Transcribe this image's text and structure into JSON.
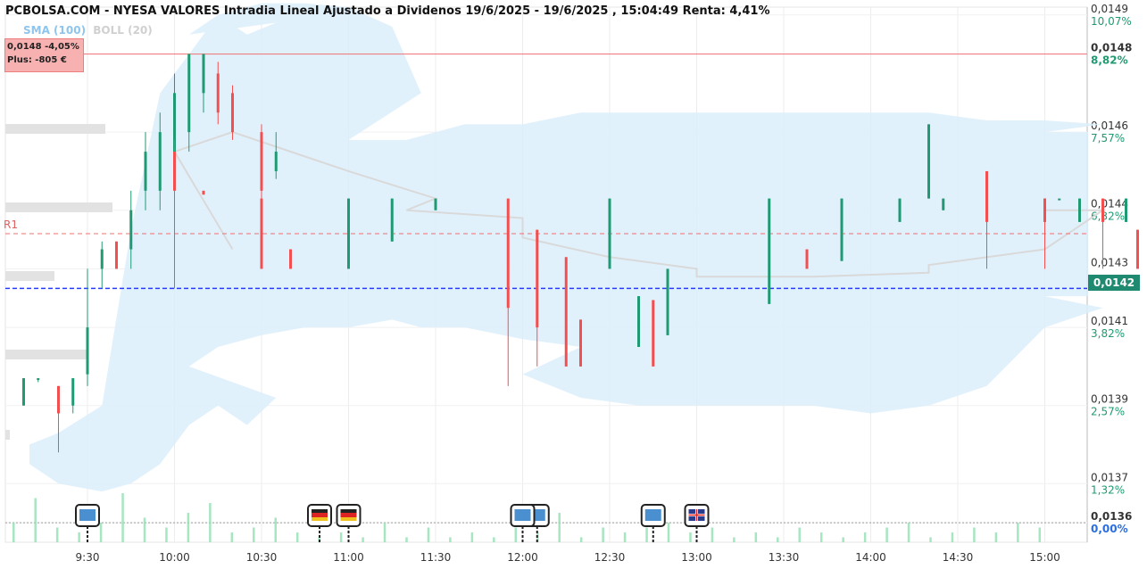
{
  "title": "PCBOLSA.COM - NYESA VALORES Intradia Lineal Ajustado a Dividenos 19/6/2025 - 19/6/2025 , 15:04:49 Renta: 4,41%",
  "indicators": {
    "sma": "SMA (100)",
    "boll": "BOLL (20)"
  },
  "price_box": {
    "line1": "0,0148  -4,05%",
    "line2": "Plus: -805 €"
  },
  "r1_label": "R1",
  "current_price_label": "0,0142",
  "colors": {
    "up": "#1f9a73",
    "down": "#f25050",
    "band": "#dceefb",
    "sma": "#d9d9d9",
    "resistance": "#f08080",
    "current": "#2a3cf0",
    "volume": "#90e0b0"
  },
  "chart_data": {
    "type": "line",
    "ylim": [
      0.01355,
      0.01492
    ],
    "y_ticks": [
      {
        "price": "0,0149",
        "pct": "10,07%",
        "value": 0.0149
      },
      {
        "price": "0,0148",
        "pct": "8,82%",
        "value": 0.0148
      },
      {
        "price": "0,0146",
        "pct": "7,57%",
        "value": 0.0146
      },
      {
        "price": "0,0144",
        "pct": "6,32%",
        "value": 0.0144
      },
      {
        "price": "0,0143",
        "pct": "",
        "value": 0.01425
      },
      {
        "price": "0,0141",
        "pct": "3,82%",
        "value": 0.0141
      },
      {
        "price": "0,0139",
        "pct": "2,57%",
        "value": 0.0139
      },
      {
        "price": "0,0137",
        "pct": "1,32%",
        "value": 0.0137
      },
      {
        "price": "0,0136",
        "pct": "0,00%",
        "value": 0.0136
      }
    ],
    "x_ticks": [
      "9:30",
      "10:00",
      "10:30",
      "11:00",
      "11:30",
      "12:00",
      "12:30",
      "13:00",
      "13:30",
      "14:00",
      "14:30",
      "15:00"
    ],
    "x_range_minutes": [
      9.05,
      15.3
    ],
    "reference_lines": {
      "resistance_high": 0.0148,
      "r1": 0.01434,
      "current": 0.0142,
      "base": 0.0136
    },
    "bollinger": [
      [
        9.1,
        0.0138,
        0.01375
      ],
      [
        9.2,
        0.01383,
        0.0137
      ],
      [
        9.35,
        0.0139,
        0.01368
      ],
      [
        9.45,
        0.01435,
        0.0137
      ],
      [
        9.55,
        0.0147,
        0.01375
      ],
      [
        9.65,
        0.0148,
        0.01385
      ],
      [
        9.75,
        0.0149,
        0.0139
      ],
      [
        9.85,
        0.01485,
        0.01385
      ],
      [
        9.95,
        0.01488,
        0.01392
      ],
      [
        10.05,
        0.01485,
        0.014
      ],
      [
        10.15,
        0.0149,
        0.01405
      ],
      [
        10.3,
        0.01493,
        0.01408
      ],
      [
        10.45,
        0.01493,
        0.0141
      ],
      [
        10.6,
        0.01492,
        0.0141
      ],
      [
        10.75,
        0.01487,
        0.01412
      ],
      [
        10.85,
        0.0147,
        0.0141
      ],
      [
        11.0,
        0.01458,
        0.0141
      ],
      [
        11.2,
        0.01458,
        0.0141
      ],
      [
        11.4,
        0.01462,
        0.0141
      ],
      [
        11.6,
        0.01462,
        0.01407
      ],
      [
        11.8,
        0.01465,
        0.01405
      ],
      [
        12.0,
        0.01465,
        0.01398
      ],
      [
        12.2,
        0.01465,
        0.01392
      ],
      [
        12.4,
        0.01465,
        0.0139
      ],
      [
        12.6,
        0.01465,
        0.0139
      ],
      [
        12.8,
        0.01465,
        0.0139
      ],
      [
        13.0,
        0.01465,
        0.0139
      ],
      [
        13.2,
        0.01465,
        0.0139
      ],
      [
        13.4,
        0.01465,
        0.0139
      ],
      [
        13.6,
        0.01465,
        0.01388
      ],
      [
        13.8,
        0.01465,
        0.01388
      ],
      [
        14.0,
        0.01465,
        0.01388
      ],
      [
        14.2,
        0.01465,
        0.0139
      ],
      [
        14.4,
        0.01463,
        0.01395
      ],
      [
        14.6,
        0.01463,
        0.0141
      ],
      [
        14.8,
        0.01462,
        0.01415
      ],
      [
        15.0,
        0.0146,
        0.01418
      ],
      [
        15.15,
        0.0146,
        0.01418
      ]
    ],
    "sma": [
      [
        9.8,
        0.0143
      ],
      [
        10.0,
        0.01455
      ],
      [
        10.2,
        0.0146
      ],
      [
        10.4,
        0.01455
      ],
      [
        10.6,
        0.0145
      ],
      [
        10.9,
        0.01443
      ],
      [
        11.2,
        0.0144
      ],
      [
        11.6,
        0.01438
      ],
      [
        12.0,
        0.01433
      ],
      [
        12.3,
        0.01428
      ],
      [
        12.6,
        0.01425
      ],
      [
        13.0,
        0.01423
      ],
      [
        13.4,
        0.01423
      ],
      [
        13.8,
        0.01424
      ],
      [
        14.2,
        0.01426
      ],
      [
        14.6,
        0.0143
      ],
      [
        14.8,
        0.0144
      ],
      [
        15.0,
        0.0144
      ],
      [
        15.15,
        0.0144
      ]
    ],
    "ohlc": [
      {
        "t": 9.08,
        "o": 0.01397,
        "c": 0.0139,
        "h": 0.01397,
        "l": 0.0139,
        "up": true
      },
      {
        "t": 9.13,
        "o": 0.01397,
        "c": 0.01397,
        "h": 0.01397,
        "l": 0.01396,
        "up": true
      },
      {
        "t": 9.2,
        "o": 0.01395,
        "c": 0.01388,
        "h": 0.01395,
        "l": 0.01378,
        "up": false
      },
      {
        "t": 9.25,
        "o": 0.0139,
        "c": 0.01397,
        "h": 0.01397,
        "l": 0.01388,
        "up": true
      },
      {
        "t": 9.3,
        "o": 0.01398,
        "c": 0.0141,
        "h": 0.01425,
        "l": 0.01395,
        "up": true
      },
      {
        "t": 9.35,
        "o": 0.01425,
        "c": 0.0143,
        "h": 0.01432,
        "l": 0.0142,
        "up": true
      },
      {
        "t": 9.4,
        "o": 0.01432,
        "c": 0.01425,
        "h": 0.01432,
        "l": 0.01425,
        "up": false
      },
      {
        "t": 9.45,
        "o": 0.0143,
        "c": 0.0144,
        "h": 0.01445,
        "l": 0.01425,
        "up": true
      },
      {
        "t": 9.5,
        "o": 0.01445,
        "c": 0.01455,
        "h": 0.0146,
        "l": 0.0144,
        "up": true
      },
      {
        "t": 9.55,
        "o": 0.01445,
        "c": 0.0146,
        "h": 0.01465,
        "l": 0.0144,
        "up": true
      },
      {
        "t": 9.6,
        "o": 0.01455,
        "c": 0.0147,
        "h": 0.01475,
        "l": 0.0145,
        "up": true
      },
      {
        "t": 9.65,
        "o": 0.0146,
        "c": 0.0148,
        "h": 0.0148,
        "l": 0.01455,
        "up": true
      },
      {
        "t": 9.7,
        "o": 0.0147,
        "c": 0.0148,
        "h": 0.0148,
        "l": 0.01465,
        "up": true
      },
      {
        "t": 9.75,
        "o": 0.01475,
        "c": 0.01465,
        "h": 0.01478,
        "l": 0.01462,
        "up": false
      },
      {
        "t": 9.8,
        "o": 0.0147,
        "c": 0.0146,
        "h": 0.01472,
        "l": 0.01458,
        "up": false
      },
      {
        "t": 9.9,
        "o": 0.0146,
        "c": 0.01445,
        "h": 0.01462,
        "l": 0.0144,
        "up": false
      },
      {
        "t": 9.95,
        "o": 0.0145,
        "c": 0.01455,
        "h": 0.0146,
        "l": 0.01448,
        "up": true
      },
      {
        "t": 10.0,
        "o": 0.01455,
        "c": 0.01445,
        "h": 0.01458,
        "l": 0.0142,
        "up": false
      },
      {
        "t": 10.1,
        "o": 0.01445,
        "c": 0.01444,
        "h": 0.01445,
        "l": 0.01444,
        "up": false
      },
      {
        "t": 10.3,
        "o": 0.01443,
        "c": 0.01425,
        "h": 0.01443,
        "l": 0.01425,
        "up": false
      },
      {
        "t": 10.4,
        "o": 0.0143,
        "c": 0.01425,
        "h": 0.0143,
        "l": 0.01425,
        "up": false
      },
      {
        "t": 10.6,
        "o": 0.01425,
        "c": 0.01443,
        "h": 0.01443,
        "l": 0.01425,
        "up": true
      },
      {
        "t": 10.75,
        "o": 0.01432,
        "c": 0.01443,
        "h": 0.01443,
        "l": 0.01432,
        "up": true
      },
      {
        "t": 10.9,
        "o": 0.0144,
        "c": 0.01443,
        "h": 0.01443,
        "l": 0.0144,
        "up": true
      },
      {
        "t": 11.55,
        "o": 0.01443,
        "c": 0.01415,
        "h": 0.01443,
        "l": 0.01395,
        "up": false
      },
      {
        "t": 11.9,
        "o": 0.01425,
        "c": 0.01443,
        "h": 0.01443,
        "l": 0.01425,
        "up": true
      },
      {
        "t": 12.05,
        "o": 0.01435,
        "c": 0.0141,
        "h": 0.01435,
        "l": 0.014,
        "up": false
      },
      {
        "t": 12.15,
        "o": 0.01428,
        "c": 0.014,
        "h": 0.01428,
        "l": 0.014,
        "up": false
      },
      {
        "t": 12.2,
        "o": 0.01412,
        "c": 0.014,
        "h": 0.01412,
        "l": 0.014,
        "up": false
      },
      {
        "t": 12.4,
        "o": 0.01405,
        "c": 0.01418,
        "h": 0.01418,
        "l": 0.01405,
        "up": true
      },
      {
        "t": 12.45,
        "o": 0.01417,
        "c": 0.014,
        "h": 0.01417,
        "l": 0.014,
        "up": false
      },
      {
        "t": 12.5,
        "o": 0.01408,
        "c": 0.01425,
        "h": 0.01425,
        "l": 0.01408,
        "up": true
      },
      {
        "t": 12.85,
        "o": 0.01416,
        "c": 0.01443,
        "h": 0.01443,
        "l": 0.01416,
        "up": true
      },
      {
        "t": 12.98,
        "o": 0.0143,
        "c": 0.01425,
        "h": 0.0143,
        "l": 0.01425,
        "up": false
      },
      {
        "t": 13.5,
        "o": 0.01427,
        "c": 0.01443,
        "h": 0.01443,
        "l": 0.01427,
        "up": true
      },
      {
        "t": 13.7,
        "o": 0.01437,
        "c": 0.01443,
        "h": 0.01443,
        "l": 0.01437,
        "up": true
      },
      {
        "t": 13.85,
        "o": 0.0144,
        "c": 0.01443,
        "h": 0.01443,
        "l": 0.0144,
        "up": true
      },
      {
        "t": 14.2,
        "o": 0.01443,
        "c": 0.01462,
        "h": 0.01462,
        "l": 0.01443,
        "up": true
      },
      {
        "t": 14.4,
        "o": 0.0145,
        "c": 0.01437,
        "h": 0.0145,
        "l": 0.01425,
        "up": false
      },
      {
        "t": 14.6,
        "o": 0.01443,
        "c": 0.01437,
        "h": 0.01443,
        "l": 0.01425,
        "up": false
      },
      {
        "t": 14.72,
        "o": 0.01437,
        "c": 0.01443,
        "h": 0.01443,
        "l": 0.01437,
        "up": true
      },
      {
        "t": 14.88,
        "o": 0.01437,
        "c": 0.01443,
        "h": 0.01443,
        "l": 0.01437,
        "up": true
      },
      {
        "t": 15.0,
        "o": 0.01443,
        "c": 0.01437,
        "h": 0.01443,
        "l": 0.01425,
        "up": false
      },
      {
        "t": 15.05,
        "o": 0.01443,
        "c": 0.01443,
        "h": 0.01443,
        "l": 0.01443,
        "up": true
      },
      {
        "t": 15.2,
        "o": 0.01443,
        "c": 0.01437,
        "h": 0.01443,
        "l": 0.01425,
        "up": false
      },
      {
        "t": 15.32,
        "o": 0.01435,
        "c": 0.01425,
        "h": 0.01435,
        "l": 0.01425,
        "up": false
      },
      {
        "t": 15.48,
        "o": 0.0144,
        "c": 0.0143,
        "h": 0.01442,
        "l": 0.01425,
        "up": false
      },
      {
        "t": 15.62,
        "o": 0.01434,
        "c": 0.01425,
        "h": 0.01434,
        "l": 0.01425,
        "up": false
      },
      {
        "t": 15.7,
        "o": 0.01427,
        "c": 0.01425,
        "h": 0.01427,
        "l": 0.01425,
        "up": false
      }
    ],
    "volume": [
      0.4,
      0.9,
      0.3,
      0.2,
      0.4,
      1.0,
      0.5,
      0.3,
      0.6,
      0.8,
      0.2,
      0.3,
      0.5,
      0.2,
      0.1,
      0.2,
      0.1,
      0.4,
      0.1,
      0.3,
      0.1,
      0.2,
      0.1,
      0.3,
      0.2,
      0.6,
      0.1,
      0.3,
      0.2,
      0.3,
      0.4,
      0.2,
      0.3,
      0.1,
      0.2,
      0.1,
      0.3,
      0.2,
      0.1,
      0.2,
      0.3,
      0.4,
      0.1,
      0.2,
      0.3,
      0.2,
      0.4,
      0.3
    ],
    "event_markers": [
      {
        "t": 9.3,
        "icon": "chart-icon"
      },
      {
        "t": 10.5,
        "icon": "germany-flag-icon"
      },
      {
        "t": 11.0,
        "icon": "germany-flag-icon"
      },
      {
        "t": 11.65,
        "icon": "chart-icon"
      },
      {
        "t": 12.0,
        "icon": "chart-icon"
      },
      {
        "t": 12.45,
        "icon": "chart-icon"
      },
      {
        "t": 13.0,
        "icon": "uk-flag-icon"
      }
    ]
  }
}
